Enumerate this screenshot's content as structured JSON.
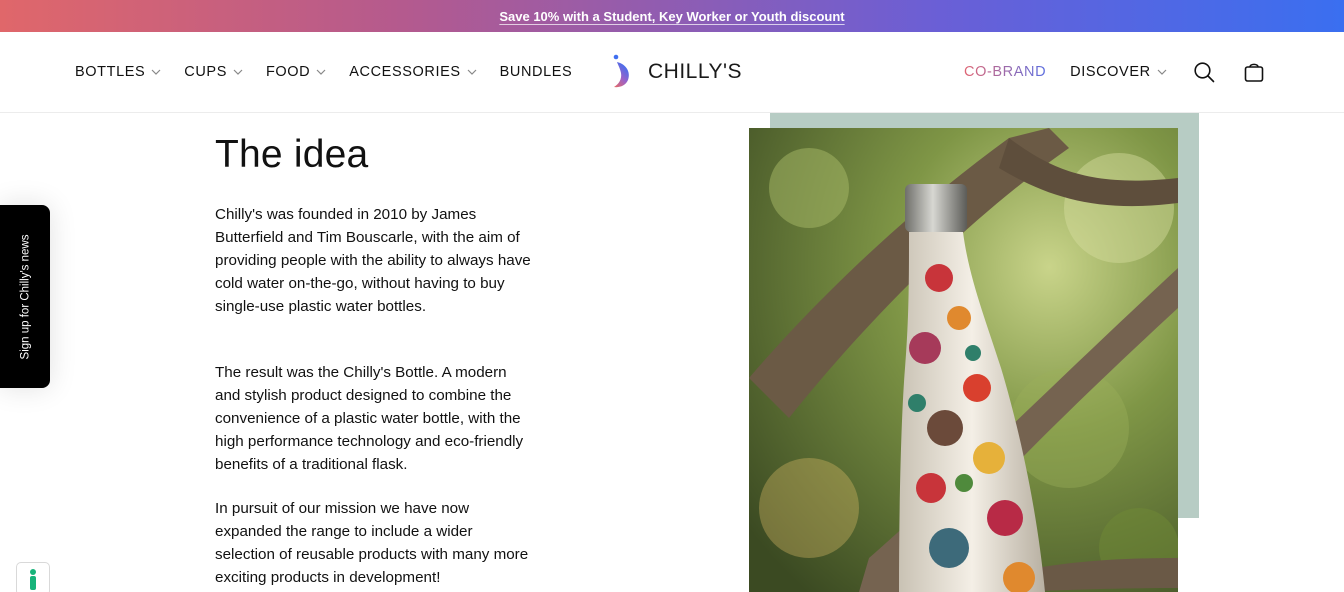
{
  "announcement": {
    "text": "Save 10% with a Student, Key Worker or Youth discount"
  },
  "nav": {
    "left": [
      {
        "label": "BOTTLES",
        "has_dropdown": true
      },
      {
        "label": "CUPS",
        "has_dropdown": true
      },
      {
        "label": "FOOD",
        "has_dropdown": true
      },
      {
        "label": "ACCESSORIES",
        "has_dropdown": true
      },
      {
        "label": "BUNDLES",
        "has_dropdown": false
      }
    ],
    "right": [
      {
        "label": "CO-BRAND",
        "has_dropdown": false
      },
      {
        "label": "DISCOVER",
        "has_dropdown": true
      }
    ],
    "icons": [
      "search-icon",
      "bag-icon"
    ]
  },
  "logo": {
    "text": "CHILLY'S"
  },
  "signup_tab": {
    "label": "Sign up for Chilly's news"
  },
  "main": {
    "heading": "The idea",
    "paragraphs": [
      "Chilly's was founded in 2010 by James Butterfield and Tim Bouscarle, with the aim of providing people with the ability to always have cold water on-the-go, without having to buy single-use plastic water bottles.",
      "The result was the Chilly's Bottle. A modern and stylish product designed to combine the convenience of a plastic water bottle, with the high performance technology and eco-friendly benefits of a traditional flask.",
      "In pursuit of our mission we have now expanded the range to include a wider selection of reusable products with many more exciting products in development!"
    ]
  },
  "colors": {
    "accent_gradient_start": "#e0676a",
    "accent_gradient_end": "#3a6ff0",
    "image_frame": "#b7ccc4"
  }
}
